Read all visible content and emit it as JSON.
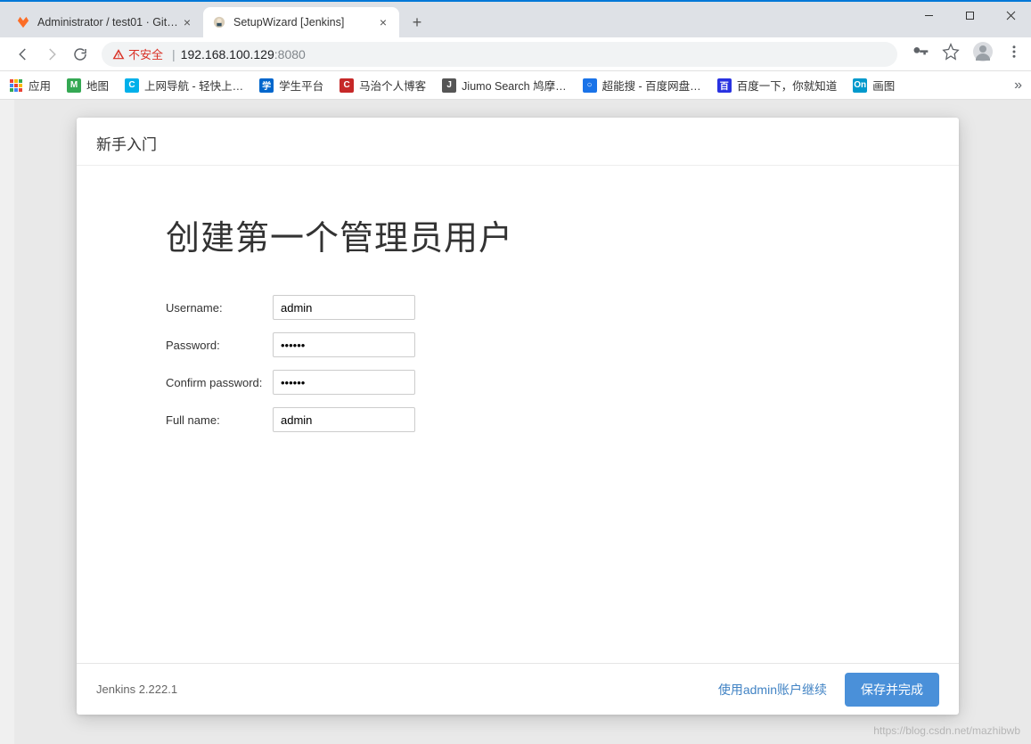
{
  "window": {
    "tabs": [
      {
        "title": "Administrator / test01 · GitLab",
        "active": false,
        "favicon_color": "#fc6d26"
      },
      {
        "title": "SetupWizard [Jenkins]",
        "active": true,
        "favicon_color": "#d33833"
      }
    ]
  },
  "address": {
    "insecure_label": "不安全",
    "url_host": "192.168.100.129",
    "url_port": ":8080"
  },
  "bookmarks": {
    "apps_label": "应用",
    "items": [
      {
        "label": "地图",
        "color": "#34a853"
      },
      {
        "label": "上网导航 - 轻快上…",
        "color": "#00b0ea"
      },
      {
        "label": "学生平台",
        "color": "#0066cc"
      },
      {
        "label": "马治个人博客",
        "color": "#c62828"
      },
      {
        "label": "Jiumo Search 鸠摩…",
        "color": "#555555"
      },
      {
        "label": "超能搜 - 百度网盘…",
        "color": "#1a73e8"
      },
      {
        "label": "百度一下，你就知道",
        "color": "#2932e1"
      },
      {
        "label": "画图",
        "color": "#0099cc"
      }
    ]
  },
  "wizard": {
    "header": "新手入门",
    "title": "创建第一个管理员用户",
    "fields": {
      "username_label": "Username:",
      "username_value": "admin",
      "password_label": "Password:",
      "password_value": "••••••",
      "confirm_label": "Confirm password:",
      "confirm_value": "••••••",
      "fullname_label": "Full name:",
      "fullname_value": "admin"
    },
    "version": "Jenkins 2.222.1",
    "skip_label": "使用admin账户继续",
    "save_label": "保存并完成"
  },
  "watermark": "https://blog.csdn.net/mazhibwb"
}
